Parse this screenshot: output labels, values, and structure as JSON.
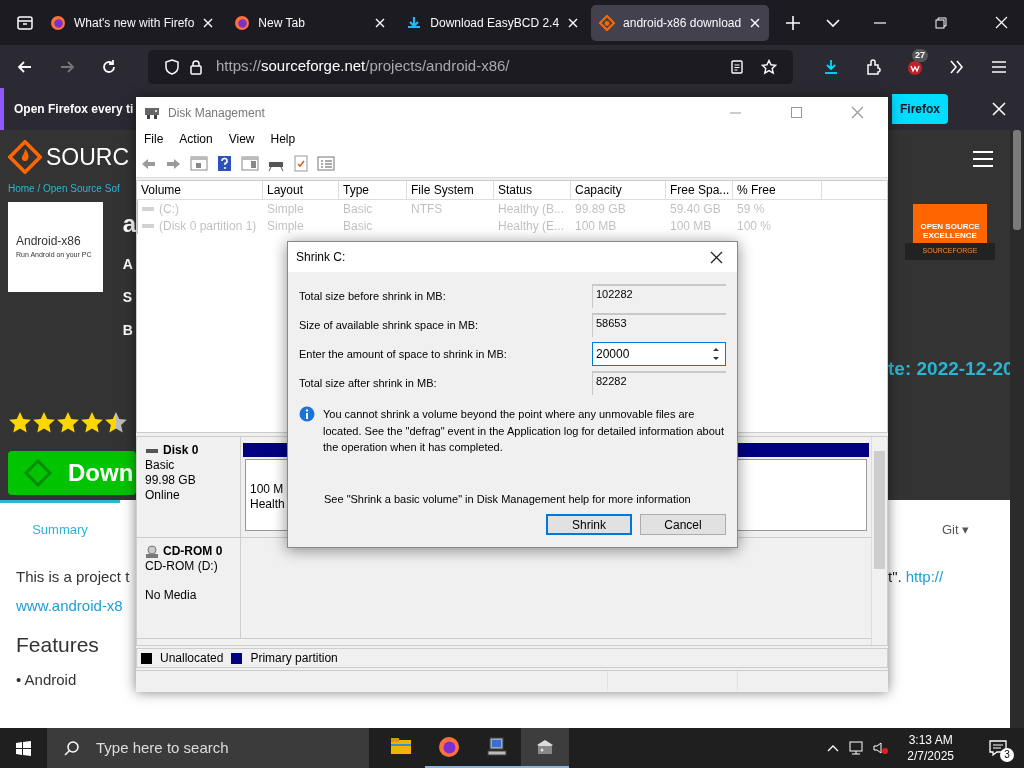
{
  "browser": {
    "tabs": [
      {
        "title": "What's new with Firefo",
        "kind": "firefox",
        "selected": false
      },
      {
        "title": "New Tab",
        "kind": "firefox",
        "selected": false
      },
      {
        "title": "Download EasyBCD 2.4",
        "kind": "download",
        "selected": false
      },
      {
        "title": "android-x86 download",
        "kind": "sourceforge",
        "selected": true
      }
    ],
    "url": {
      "scheme": "https://",
      "host": "sourceforge.net",
      "path": "/projects/android-x86/"
    },
    "extension_badge": "27",
    "notification": {
      "text": "Open Firefox every ti",
      "button": "Firefox"
    }
  },
  "page": {
    "logo_text": "SOURC",
    "breadcrumb": "Home / Open Source Sof",
    "project_card": {
      "title": "Android-x86",
      "subtitle": "Run Android on your PC"
    },
    "header_letters": [
      "a",
      "A",
      "S",
      "B"
    ],
    "stars": 4.5,
    "download_button": "Down",
    "badge": {
      "line1": "OPEN SOURCE",
      "line2": "EXCELLENCE",
      "ribbon": "SOURCEFORGE"
    },
    "date_text": "te: 2022-12-20",
    "tabs": [
      {
        "label": "Summary",
        "selected": true
      },
      {
        "label": "Git ▾",
        "selected": false
      }
    ],
    "description_left": "This is a project t",
    "description_right": "t\".",
    "description_link": "http://",
    "description_link2": "www.android-x8",
    "features_heading": "Features",
    "features": [
      "• Android"
    ]
  },
  "disk_management": {
    "title": "Disk Management",
    "menu": [
      "File",
      "Action",
      "View",
      "Help"
    ],
    "columns": [
      "Volume",
      "Layout",
      "Type",
      "File System",
      "Status",
      "Capacity",
      "Free Spa...",
      "% Free"
    ],
    "volumes": [
      {
        "cells": [
          "(C:)",
          "Simple",
          "Basic",
          "NTFS",
          "Healthy (B...",
          "99.89 GB",
          "59.40 GB",
          "59 %"
        ]
      },
      {
        "cells": [
          "(Disk 0 partition 1)",
          "Simple",
          "Basic",
          null,
          "Healthy (E...",
          "100 MB",
          "100 MB",
          "100 %"
        ]
      }
    ],
    "disks": [
      {
        "name": "Disk 0",
        "kind": "disk",
        "lines": [
          "Basic",
          "99.98 GB",
          "Online"
        ],
        "partition_lines": [
          "100 M",
          "Health"
        ]
      },
      {
        "name": "CD-ROM 0",
        "kind": "cdrom",
        "lines": [
          "CD-ROM (D:)",
          "No Media"
        ]
      }
    ],
    "legend": [
      {
        "label": "Unallocated",
        "color": "#000000"
      },
      {
        "label": "Primary partition",
        "color": "#000080"
      }
    ]
  },
  "shrink_dialog": {
    "title": "Shrink C:",
    "fields": [
      {
        "label": "Total size before shrink in MB:",
        "value": "102282",
        "kind": "readonly"
      },
      {
        "label": "Size of available shrink space in MB:",
        "value": "58653",
        "kind": "readonly"
      },
      {
        "label": "Enter the amount of space to shrink in MB:",
        "value": "20000",
        "kind": "spin"
      },
      {
        "label": "Total size after shrink in MB:",
        "value": "82282",
        "kind": "readonly"
      }
    ],
    "info": "You cannot shrink a volume beyond the point where any unmovable files are located. See the \"defrag\" event in the Application log for detailed information about the operation when it has completed.",
    "help": "See \"Shrink a basic volume\" in Disk Management help for more information",
    "buttons": [
      {
        "label": "Shrink",
        "default": true
      },
      {
        "label": "Cancel",
        "default": false
      }
    ]
  },
  "taskbar": {
    "search_placeholder": "Type here to search",
    "apps": [
      {
        "kind": "folder",
        "running": false,
        "selected": false
      },
      {
        "kind": "firefox",
        "running": true,
        "selected": false
      },
      {
        "kind": "computer",
        "running": true,
        "selected": false
      },
      {
        "kind": "disk",
        "running": true,
        "selected": true
      }
    ],
    "time": "3:13 AM",
    "date": "2/7/2025",
    "notification_count": "3"
  }
}
